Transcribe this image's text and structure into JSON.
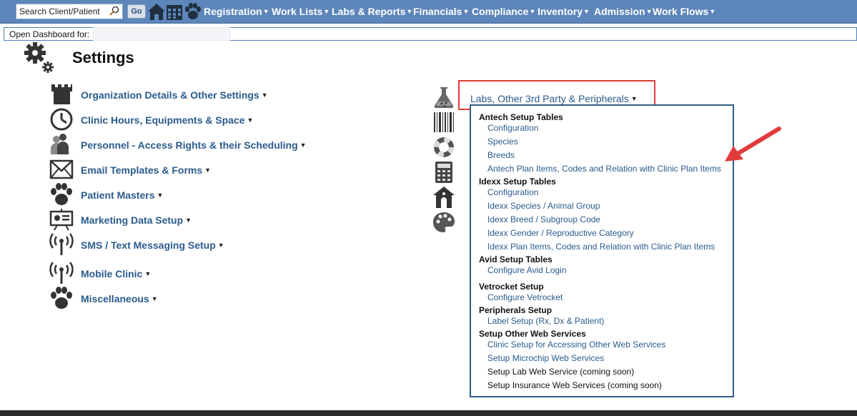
{
  "topbar": {
    "search_placeholder": "Search Client/Patient",
    "go_label": "Go",
    "nav": [
      {
        "label": "Registration"
      },
      {
        "label": "Work Lists"
      },
      {
        "label": "Labs & Reports"
      },
      {
        "label": "Financials"
      },
      {
        "label": "Compliance"
      },
      {
        "label": "Inventory"
      },
      {
        "label": "Admission"
      },
      {
        "label": "Work Flows"
      }
    ]
  },
  "dashboard": {
    "label": "Open Dashboard for:"
  },
  "page": {
    "title": "Settings"
  },
  "menu": [
    {
      "label": "Organization Details & Other Settings",
      "icon": "castle-icon"
    },
    {
      "label": "Clinic Hours, Equipments & Space",
      "icon": "clock-icon"
    },
    {
      "label": "Personnel - Access Rights & their Scheduling",
      "icon": "personnel-icon"
    },
    {
      "label": "Email Templates & Forms",
      "icon": "envelope-icon"
    },
    {
      "label": "Patient Masters",
      "icon": "paw-icon"
    },
    {
      "label": "Marketing Data Setup",
      "icon": "presentation-icon"
    },
    {
      "label": "SMS / Text Messaging Setup",
      "icon": "antenna-icon"
    },
    {
      "label": "Mobile Clinic",
      "icon": "antenna-icon"
    },
    {
      "label": "Miscellaneous",
      "icon": "paw-icon"
    }
  ],
  "labs": {
    "title": "Labs, Other 3rd Party & Peripherals",
    "sections": {
      "antech": {
        "heading": "Antech Setup Tables",
        "links": [
          "Configuration",
          "Species",
          "Breeds",
          "Antech Plan Items, Codes and Relation with Clinic Plan Items"
        ]
      },
      "idexx": {
        "heading": "Idexx Setup Tables",
        "links": [
          "Configuration",
          "Idexx Species / Animal Group",
          "Idexx Breed / Subgroup Code",
          "Idexx Gender / Reproductive Category",
          "Idexx Plan Items, Codes and Relation with Clinic Plan Items"
        ]
      },
      "avid": {
        "heading": "Avid Setup Tables",
        "links": [
          "Configure Avid Login"
        ]
      },
      "vetrocket": {
        "heading": "Vetrocket Setup",
        "links": [
          "Configure Vetrocket"
        ]
      },
      "peripherals": {
        "heading": "Peripherals Setup",
        "links": [
          "Label Setup (Rx, Dx & Patient)"
        ]
      },
      "webservices": {
        "heading": "Setup Other Web Services",
        "links": [
          "Clinic Setup for Accessing Other Web Services",
          "Setup Microchip Web Services"
        ],
        "disabled": [
          "Setup Lab Web Service (coming soon)",
          "Setup Insurance Web Services (coming soon)"
        ]
      }
    }
  },
  "colors": {
    "topbar": "#5d86bb",
    "link": "#2a5b8c",
    "highlight": "#e23b3b",
    "dropdown_border": "#2f5d86"
  }
}
